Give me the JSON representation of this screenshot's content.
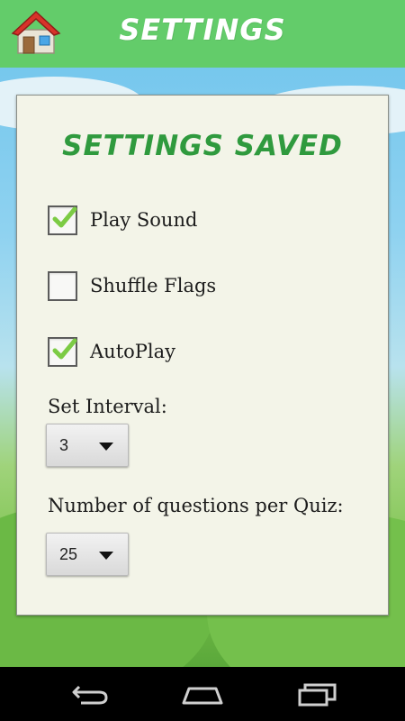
{
  "header": {
    "title": "SETTINGS",
    "home_icon": "home-icon"
  },
  "panel": {
    "heading": "SETTINGS SAVED",
    "options": [
      {
        "label": "Play Sound",
        "checked": true
      },
      {
        "label": "Shuffle Flags",
        "checked": false
      },
      {
        "label": "AutoPlay",
        "checked": true
      }
    ],
    "interval": {
      "label": "Set Interval:",
      "value": "3"
    },
    "questions": {
      "label": "Number of questions per Quiz:",
      "value": "25"
    }
  },
  "navbar": {
    "icons": [
      "back-icon",
      "home-nav-icon",
      "recent-apps-icon"
    ]
  },
  "colors": {
    "topbar": "#63cc6a",
    "heading": "#2f9a3e",
    "check": "#7ccb45",
    "panel": "#f3f4e8"
  }
}
